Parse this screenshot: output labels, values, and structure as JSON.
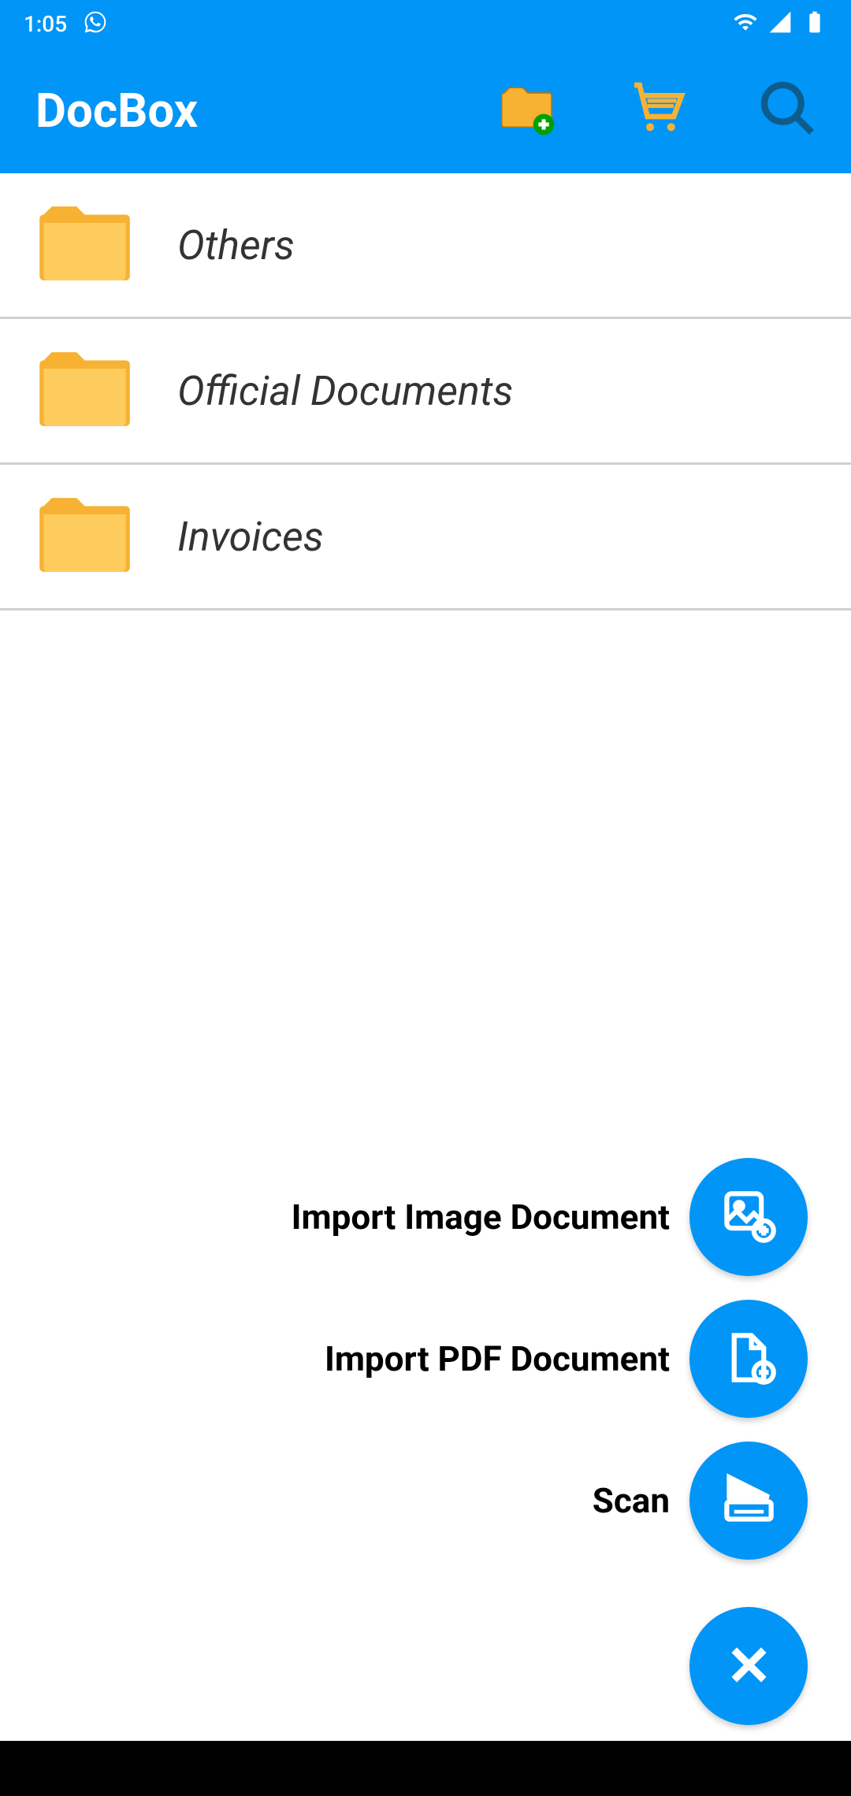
{
  "status": {
    "time": "1:05"
  },
  "header": {
    "title": "DocBox"
  },
  "folders": [
    {
      "name": "Others"
    },
    {
      "name": "Official Documents"
    },
    {
      "name": "Invoices"
    }
  ],
  "fab_menu": {
    "import_image": "Import Image Document",
    "import_pdf": "Import PDF Document",
    "scan": "Scan"
  },
  "colors": {
    "primary": "#0095f6",
    "folder_yellow": "#f7b233"
  }
}
